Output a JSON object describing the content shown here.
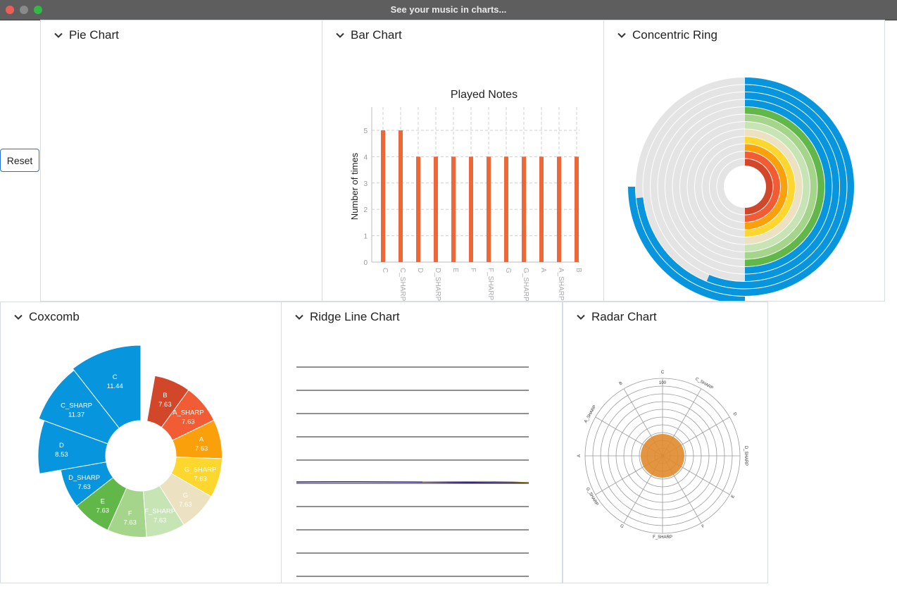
{
  "window": {
    "title": "See your music in charts..."
  },
  "reset_label": "Reset",
  "colors": {
    "accent": "#2a6fd6",
    "bar": "#ef6637",
    "ring_outer": "#0795dd",
    "ridge_line": "#222222"
  },
  "panels": {
    "pie": {
      "title": "Pie Chart"
    },
    "bar": {
      "title": "Bar Chart"
    },
    "ring": {
      "title": "Concentric Ring"
    },
    "coxcomb": {
      "title": "Coxcomb"
    },
    "ridge": {
      "title": "Ridge Line Chart"
    },
    "radar": {
      "title": "Radar Chart"
    }
  },
  "chart_data": [
    {
      "id": "bar",
      "type": "bar",
      "title": "Played Notes",
      "ylabel": "Number of times",
      "xlabel": "",
      "categories": [
        "C",
        "C_SHARP",
        "D",
        "D_SHARP",
        "E",
        "F",
        "F_SHARP",
        "G",
        "G_SHARP",
        "A",
        "A_SHARP",
        "B"
      ],
      "values": [
        5,
        5,
        4,
        4,
        4,
        4,
        4,
        4,
        4,
        4,
        4,
        4
      ],
      "ylim": [
        0,
        5
      ],
      "yticks": [
        "0",
        "1",
        "2",
        "3",
        "4",
        "5"
      ],
      "grid": true,
      "color": "#ef6637"
    },
    {
      "id": "coxcomb",
      "type": "pie",
      "slices": [
        {
          "label": "B",
          "value": "7.63",
          "color": "#d2462a"
        },
        {
          "label": "A_SHARP",
          "value": "7.63",
          "color": "#f25c34"
        },
        {
          "label": "A",
          "value": "7.63",
          "color": "#faa00a"
        },
        {
          "label": "G_SHARP",
          "value": "7.63",
          "color": "#fdd62e"
        },
        {
          "label": "G",
          "value": "7.63",
          "color": "#ece1c0"
        },
        {
          "label": "F_SHARP",
          "value": "7.63",
          "color": "#c7e4b5"
        },
        {
          "label": "F",
          "value": "7.63",
          "color": "#a5d48b"
        },
        {
          "label": "E",
          "value": "7.63",
          "color": "#61b849"
        },
        {
          "label": "D_SHARP",
          "value": "7.63",
          "color": "#0795dd"
        },
        {
          "label": "D",
          "value": "8.53",
          "color": "#0795dd"
        },
        {
          "label": "C_SHARP",
          "value": "11.37",
          "color": "#0795dd"
        },
        {
          "label": "C",
          "value": "11.44",
          "color": "#0795dd"
        }
      ]
    },
    {
      "id": "radar",
      "type": "radar",
      "axes": [
        "C",
        "C_SHARP",
        "D",
        "D_SHARP",
        "E",
        "F",
        "F_SHARP",
        "G",
        "G_SHARP",
        "A",
        "A_SHARP",
        "B"
      ],
      "max_label": "100",
      "fill": "#e08a2c"
    }
  ]
}
